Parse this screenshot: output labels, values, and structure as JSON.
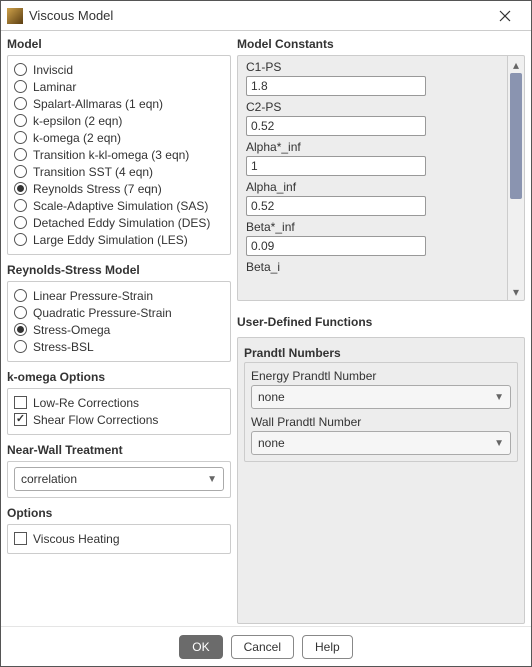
{
  "window": {
    "title": "Viscous Model"
  },
  "sections": {
    "model": "Model",
    "rsm": "Reynolds-Stress Model",
    "komega": "k-omega Options",
    "nearwall": "Near-Wall Treatment",
    "options": "Options",
    "constants": "Model Constants",
    "udf": "User-Defined Functions",
    "prandtl": "Prandtl Numbers"
  },
  "model": {
    "items": [
      "Inviscid",
      "Laminar",
      "Spalart-Allmaras (1 eqn)",
      "k-epsilon (2 eqn)",
      "k-omega (2 eqn)",
      "Transition k-kl-omega (3 eqn)",
      "Transition SST (4 eqn)",
      "Reynolds Stress (7 eqn)",
      "Scale-Adaptive Simulation (SAS)",
      "Detached Eddy Simulation (DES)",
      "Large Eddy Simulation (LES)"
    ],
    "selected_index": 7
  },
  "rsm": {
    "items": [
      "Linear Pressure-Strain",
      "Quadratic Pressure-Strain",
      "Stress-Omega",
      "Stress-BSL"
    ],
    "selected_index": 2
  },
  "komega": {
    "items": [
      "Low-Re Corrections",
      "Shear Flow Corrections"
    ],
    "checked": [
      false,
      true
    ]
  },
  "nearwall": {
    "value": "correlation"
  },
  "options": {
    "items": [
      "Viscous Heating"
    ],
    "checked": [
      false
    ]
  },
  "constants": [
    {
      "label": "C1-PS",
      "value": "1.8"
    },
    {
      "label": "C2-PS",
      "value": "0.52"
    },
    {
      "label": "Alpha*_inf",
      "value": "1"
    },
    {
      "label": "Alpha_inf",
      "value": "0.52"
    },
    {
      "label": "Beta*_inf",
      "value": "0.09"
    },
    {
      "label": "Beta_i",
      "value": ""
    }
  ],
  "udf": {
    "energy_label": "Energy Prandtl Number",
    "energy_value": "none",
    "wall_label": "Wall Prandtl Number",
    "wall_value": "none"
  },
  "buttons": {
    "ok": "OK",
    "cancel": "Cancel",
    "help": "Help"
  }
}
